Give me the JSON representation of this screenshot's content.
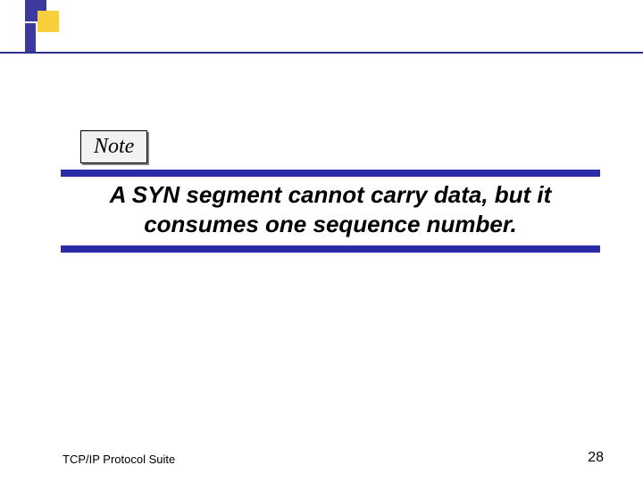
{
  "note_label": "Note",
  "statement": "A SYN segment cannot carry data, but it consumes one sequence number.",
  "footer": {
    "left": "TCP/IP Protocol Suite",
    "page_number": "28"
  },
  "colors": {
    "accent_blue": "#2b2ba8",
    "accent_yellow": "#f8cf3a"
  }
}
